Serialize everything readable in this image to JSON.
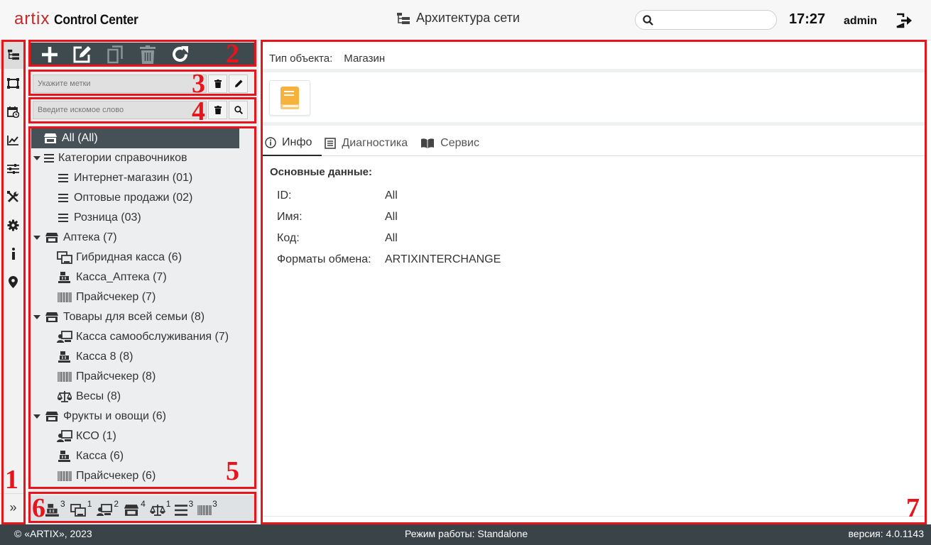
{
  "header": {
    "logo_brand": "artix",
    "logo_product": "Control Center",
    "page_title": "Архитектура сети",
    "search_value": "",
    "time": "17:27",
    "user": "admin"
  },
  "iconbar": {
    "items": [
      "network-tree-icon",
      "layout-icon",
      "calendar-clock-icon",
      "chart-icon",
      "sliders-icon",
      "tools-icon",
      "gear-icon",
      "info-icon",
      "location-pin-icon"
    ],
    "expand_label": "»"
  },
  "toolbar": {
    "buttons": [
      "add-icon",
      "edit-icon",
      "copy-icon",
      "delete-icon",
      "refresh-icon"
    ]
  },
  "tags_filter": {
    "placeholder": "Укажите метки"
  },
  "search_filter": {
    "placeholder": "Введите искомое слово"
  },
  "tree": {
    "root": "All (All)",
    "categories": {
      "label": "Категории справочников",
      "children": [
        "Интернет-магазин (01)",
        "Оптовые продажи (02)",
        "Розница (03)"
      ]
    },
    "stores": [
      {
        "label": "Аптека (7)",
        "children": [
          {
            "icon": "hybrid-pos-icon",
            "label": "Гибридная касса (6)"
          },
          {
            "icon": "pos-icon",
            "label": "Касса_Аптека (7)"
          },
          {
            "icon": "barcode-icon",
            "label": "Прайсчекер (7)"
          }
        ]
      },
      {
        "label": "Товары для всей семьи (8)",
        "children": [
          {
            "icon": "self-checkout-icon",
            "label": "Касса самообслуживания (7)"
          },
          {
            "icon": "pos-icon",
            "label": "Касса 8 (8)"
          },
          {
            "icon": "barcode-icon",
            "label": "Прайсчекер (8)"
          },
          {
            "icon": "scales-icon",
            "label": "Весы (8)"
          }
        ]
      },
      {
        "label": "Фрукты и овощи (6)",
        "children": [
          {
            "icon": "self-checkout-icon",
            "label": "КСО (1)"
          },
          {
            "icon": "pos-icon",
            "label": "Касса (6)"
          },
          {
            "icon": "barcode-icon",
            "label": "Прайсчекер (6)"
          }
        ]
      }
    ]
  },
  "bottom_counts": [
    {
      "icon": "pos-icon",
      "count": "3"
    },
    {
      "icon": "hybrid-pos-icon",
      "count": "1"
    },
    {
      "icon": "self-checkout-icon",
      "count": "2"
    },
    {
      "icon": "store-icon",
      "count": "4"
    },
    {
      "icon": "scales-icon",
      "count": "1"
    },
    {
      "icon": "list-icon",
      "count": "3"
    },
    {
      "icon": "barcode-icon",
      "count": "3"
    }
  ],
  "main": {
    "object_type_label": "Тип объекта:",
    "object_type_value": "Магазин",
    "tabs": [
      {
        "label": "Инфо",
        "icon": "info-circle-icon"
      },
      {
        "label": "Диагностика",
        "icon": "diagnostics-icon"
      },
      {
        "label": "Сервис",
        "icon": "book-icon"
      }
    ],
    "section_title": "Основные данные:",
    "fields": [
      {
        "key": "ID:",
        "value": "All"
      },
      {
        "key": "Имя:",
        "value": "All"
      },
      {
        "key": "Код:",
        "value": "All"
      },
      {
        "key": "Форматы обмена:",
        "value": "ARTIXINTERCHANGE"
      }
    ]
  },
  "footer": {
    "copyright": "© «ARTIX», 2023",
    "mode": "Режим работы: Standalone",
    "version": "версия: 4.0.1143"
  },
  "annotations": [
    "1",
    "2",
    "3",
    "4",
    "5",
    "6",
    "7"
  ],
  "colors": {
    "annotation": "#e8141b",
    "toolbar_bg": "#3f4a4e",
    "selected_row": "#465157",
    "footer_bg": "#3a4448",
    "brand_red": "#c62828",
    "object_icon": "#f6b23c"
  }
}
